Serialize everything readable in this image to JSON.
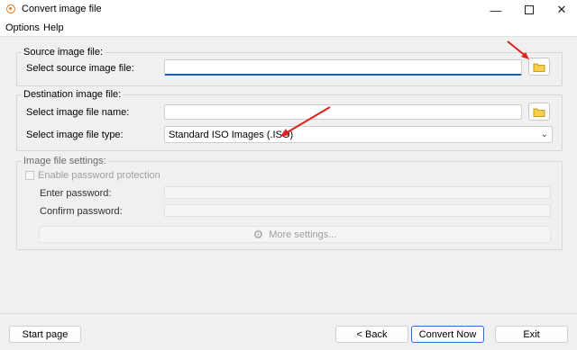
{
  "window": {
    "title": "Convert image file",
    "minimize_icon": "minimize-icon",
    "maximize_icon": "maximize-icon",
    "close_icon": "close-icon"
  },
  "menu": {
    "items": [
      "Options",
      "Help"
    ]
  },
  "source": {
    "group_title": "Source image file:",
    "label": "Select source image file:",
    "value": ""
  },
  "destination": {
    "group_title": "Destination image file:",
    "name_label": "Select image file name:",
    "name_value": "",
    "type_label": "Select image file type:",
    "type_value": "Standard ISO Images (.ISO)"
  },
  "settings": {
    "group_title": "Image file settings:",
    "password_checkbox_label": "Enable password protection",
    "password_checked": false,
    "enter_label": "Enter password:",
    "confirm_label": "Confirm password:",
    "more_label": "More settings..."
  },
  "footer": {
    "start_page": "Start page",
    "back": "< Back",
    "convert": "Convert Now",
    "exit": "Exit"
  },
  "colors": {
    "accent": "#2a6fc9",
    "arrow": "#e0201b",
    "folder": "#e8b400"
  }
}
